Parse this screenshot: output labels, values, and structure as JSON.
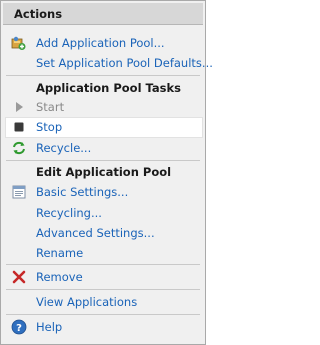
{
  "header": {
    "title": "Actions"
  },
  "actions": {
    "add_pool": "Add Application Pool...",
    "set_defaults": "Set Application Pool Defaults..."
  },
  "tasks": {
    "title": "Application Pool Tasks",
    "start": "Start",
    "stop": "Stop",
    "recycle": "Recycle..."
  },
  "edit": {
    "title": "Edit Application Pool",
    "basic_settings": "Basic Settings...",
    "recycling": "Recycling...",
    "advanced_settings": "Advanced Settings...",
    "rename": "Rename"
  },
  "remove": "Remove",
  "view_applications": "View Applications",
  "help": "Help",
  "icons": {
    "add_pool": "add-application-pool-icon",
    "start": "play-icon",
    "stop": "stop-icon",
    "recycle": "recycle-icon",
    "basic_settings": "settings-sheet-icon",
    "remove": "remove-x-icon",
    "help": "help-icon"
  }
}
